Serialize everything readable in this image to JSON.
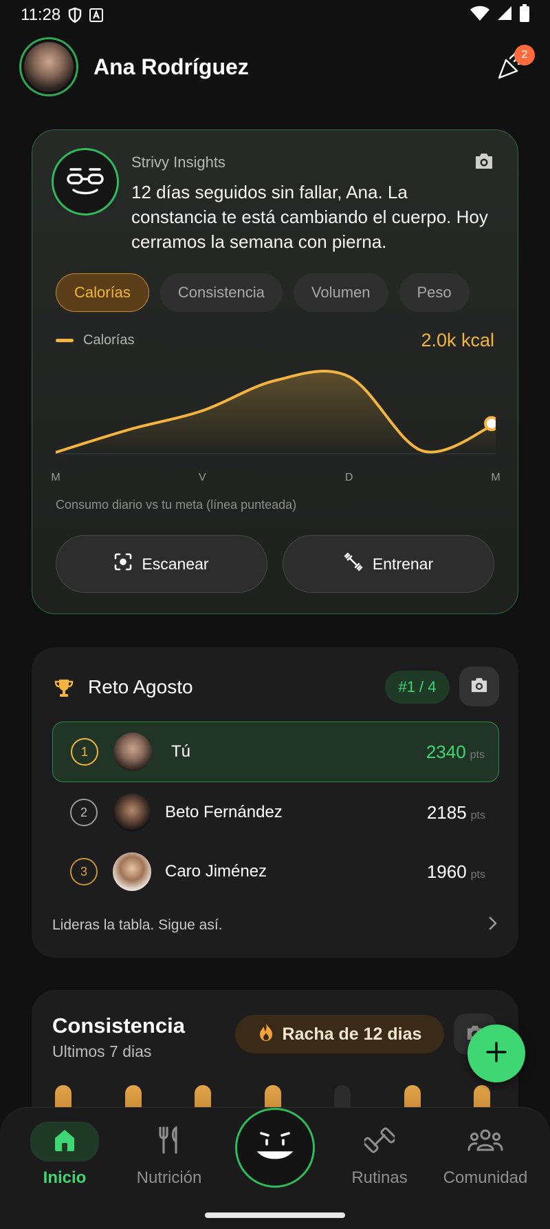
{
  "status_bar": {
    "time": "11:28"
  },
  "header": {
    "user_name": "Ana Rodríguez",
    "notification_count": "2"
  },
  "insights": {
    "source": "Strivy Insights",
    "message": "12 días seguidos sin fallar, Ana. La constancia te está cambiando el cuerpo. Hoy cerramos la semana con pierna.",
    "tabs": [
      {
        "label": "Calorías",
        "active": true
      },
      {
        "label": "Consistencia",
        "active": false
      },
      {
        "label": "Volumen",
        "active": false
      },
      {
        "label": "Peso",
        "active": false
      }
    ],
    "legend_label": "Calorías",
    "value": "2.0k kcal",
    "caption": "Consumo diario vs tu meta (línea punteada)",
    "scan_label": "Escanear",
    "train_label": "Entrenar"
  },
  "chart_data": {
    "type": "area",
    "x": [
      "M",
      "",
      "V",
      "",
      "D",
      "",
      "M"
    ],
    "x_tick_labels": [
      "M",
      "V",
      "D",
      "M"
    ],
    "values": [
      0.0,
      0.3,
      0.55,
      0.95,
      1.0,
      0.02,
      0.38
    ],
    "y_scale": "relative",
    "series_color": "#f3b440",
    "grid": false
  },
  "challenge": {
    "title": "Reto Agosto",
    "rank": "#1 / 4",
    "rows": [
      {
        "rank": "1",
        "name": "Tú",
        "points": "2340",
        "unit": "pts"
      },
      {
        "rank": "2",
        "name": "Beto Fernández",
        "points": "2185",
        "unit": "pts"
      },
      {
        "rank": "3",
        "name": "Caro Jiménez",
        "points": "1960",
        "unit": "pts"
      }
    ],
    "footer": "Lideras la tabla. Sigue así."
  },
  "consistency": {
    "title": "Consistencia",
    "subtitle": "Ultimos 7 dias",
    "streak": "Racha de 12 dias",
    "days_done": [
      1,
      1,
      1,
      1,
      0,
      1,
      1
    ]
  },
  "nav": {
    "items": [
      {
        "label": "Inicio",
        "icon": "home-icon",
        "active": true
      },
      {
        "label": "Nutrición",
        "icon": "fork-knife-icon",
        "active": false
      },
      {
        "label": "Rutinas",
        "icon": "dumbbell-icon",
        "active": false
      },
      {
        "label": "Comunidad",
        "icon": "people-icon",
        "active": false
      }
    ]
  },
  "colors": {
    "accent_green": "#3fd773",
    "accent_orange": "#f3b440"
  }
}
